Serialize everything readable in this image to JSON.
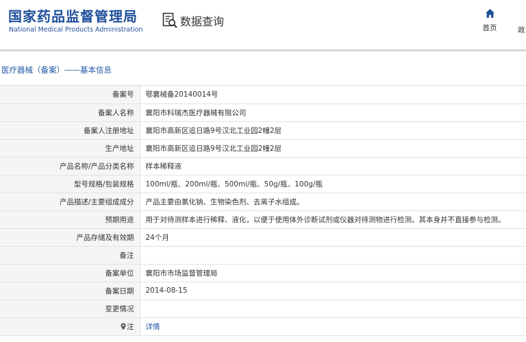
{
  "header": {
    "logo_cn": "国家药品监督管理局",
    "logo_en": "National Medical Products Administration",
    "query_label": "数据查询",
    "nav_home": "首页",
    "nav_next": "政"
  },
  "breadcrumb": "医疗器械（备案）——基本信息",
  "rows": [
    {
      "label": "备案号",
      "value": "鄂襄械备20140014号"
    },
    {
      "label": "备案人名称",
      "value": "襄阳市科瑞杰医疗器械有限公司"
    },
    {
      "label": "备案人注册地址",
      "value": "襄阳市高新区追日路9号汉北工业园2幢2层"
    },
    {
      "label": "生产地址",
      "value": "襄阳市高新区追日路9号汉北工业园2幢2层"
    },
    {
      "label": "产品名称/产品分类名称",
      "value": "样本稀释液"
    },
    {
      "label": "型号规格/包装规格",
      "value": "100ml/瓶、200ml/瓶、500ml/瓶、50g/瓶、100g/瓶"
    },
    {
      "label": "产品描述/主要组成成分",
      "value": "产品主要由氯化钠、生物染色剂、去离子水组成。"
    },
    {
      "label": "预期用途",
      "value": "用于对待测样本进行稀释、液化，以便于使用体外诊断试剂或仪器对待测物进行检测。其本身并不直接参与检测。"
    },
    {
      "label": "产品存储及有效期",
      "value": "24个月"
    },
    {
      "label": "备注",
      "value": ""
    },
    {
      "label": "备案单位",
      "value": "襄阳市市场监督管理局"
    },
    {
      "label": "备案日期",
      "value": "2014-08-15"
    },
    {
      "label": "变更情况",
      "value": ""
    },
    {
      "label": "注",
      "value": "详情"
    }
  ],
  "colors": {
    "brand_blue": "#1d4f9a",
    "link_blue": "#1f5aa6",
    "label_bg": "#f5f5f5",
    "border": "#e2e2e2"
  },
  "icons": {
    "query": "search-document-icon",
    "home": "home-icon",
    "note": "map-pin-icon"
  }
}
